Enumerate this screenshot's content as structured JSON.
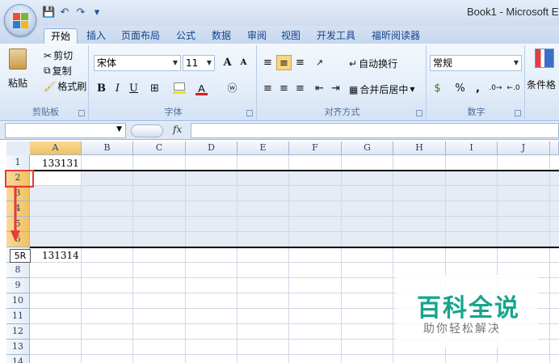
{
  "window": {
    "title": "Book1 - Microsoft E"
  },
  "tabs": [
    "开始",
    "插入",
    "页面布局",
    "公式",
    "数据",
    "审阅",
    "视图",
    "开发工具",
    "福昕阅读器"
  ],
  "ribbon": {
    "clipboard": {
      "paste": "粘贴",
      "cut": "剪切",
      "copy": "复制",
      "format_painter": "格式刷",
      "label": "剪贴板"
    },
    "font": {
      "name": "宋体",
      "size": "11",
      "grow": "A",
      "shrink": "A",
      "bold": "B",
      "italic": "I",
      "underline": "U",
      "color_letter": "A",
      "label": "字体"
    },
    "alignment": {
      "wrap": "自动换行",
      "merge": "合并后居中",
      "label": "对齐方式"
    },
    "number": {
      "format": "常规",
      "percent": "%",
      "comma": ",",
      "label": "数字"
    },
    "styles": {
      "conditional": "条件格"
    }
  },
  "formula_bar": {
    "fx": "fx"
  },
  "grid": {
    "columns": [
      "A",
      "B",
      "C",
      "D",
      "E",
      "F",
      "G",
      "H",
      "I",
      "J"
    ],
    "rows": [
      "1",
      "2",
      "3",
      "4",
      "5",
      "6",
      "5R",
      "8",
      "9",
      "10",
      "11",
      "12",
      "13",
      "14"
    ],
    "cells": {
      "A1": "133131",
      "A7": "131314"
    },
    "drag_tooltip": "5R"
  },
  "watermark": {
    "title": "百科全说",
    "subtitle": "助你轻松解决"
  },
  "colors": {
    "accent": "#15428b",
    "selection_header": "#f1c15f",
    "marker": "#e53b3b",
    "watermark": "#16a58a"
  }
}
